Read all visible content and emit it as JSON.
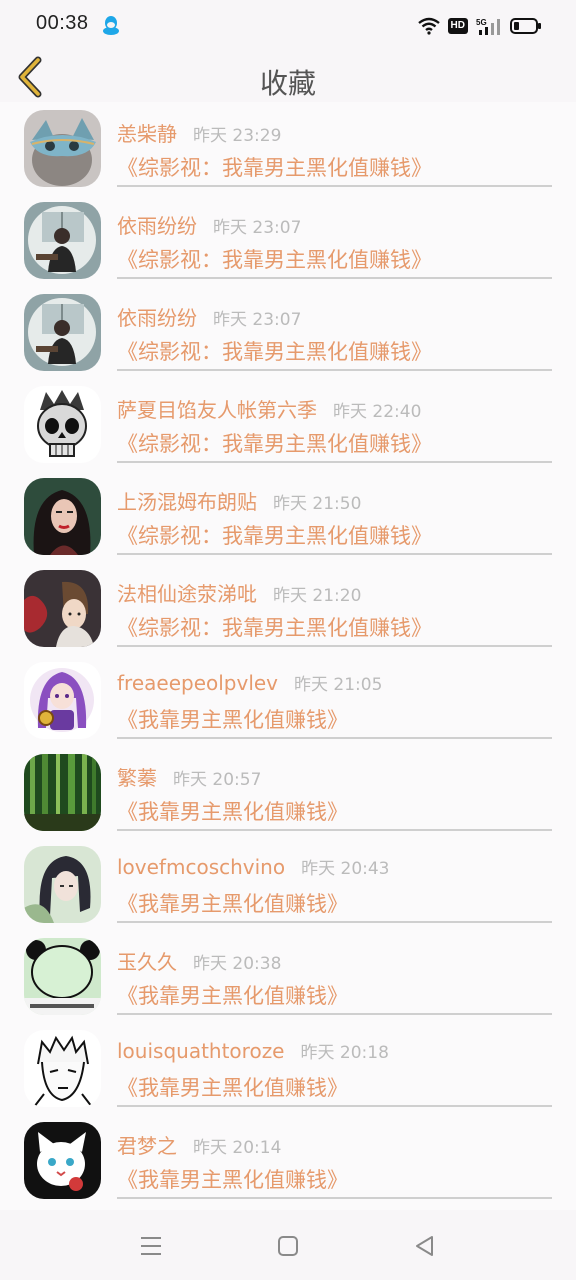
{
  "status_bar": {
    "time": "00:38",
    "hd": "HD",
    "network": "5G"
  },
  "header": {
    "title": "收藏"
  },
  "items": [
    {
      "name": "恙柴静",
      "time": "昨天 23:29",
      "book": "《综影视：我靠男主黑化值赚钱》",
      "avatar": "cat-mask-avatar"
    },
    {
      "name": "依雨纷纷",
      "time": "昨天 23:07",
      "book": "《综影视：我靠男主黑化值赚钱》",
      "avatar": "man-fisheye-avatar"
    },
    {
      "name": "依雨纷纷",
      "time": "昨天 23:07",
      "book": "《综影视：我靠男主黑化值赚钱》",
      "avatar": "man-fisheye-avatar"
    },
    {
      "name": "萨夏目馅友人帐第六季",
      "time": "昨天 22:40",
      "book": "《综影视：我靠男主黑化值赚钱》",
      "avatar": "crowned-skull-avatar"
    },
    {
      "name": "上汤混姆布朗贴",
      "time": "昨天 21:50",
      "book": "《综影视：我靠男主黑化值赚钱》",
      "avatar": "woman-portrait-avatar"
    },
    {
      "name": "法相仙途荥涕吡",
      "time": "昨天 21:20",
      "book": "《综影视：我靠男主黑化值赚钱》",
      "avatar": "anime-boy-avatar"
    },
    {
      "name": "freaeepeolpvlev",
      "time": "昨天 21:05",
      "book": "《我靠男主黑化值赚钱》",
      "avatar": "purple-anime-girl-avatar"
    },
    {
      "name": "繁蓁",
      "time": "昨天 20:57",
      "book": "《我靠男主黑化值赚钱》",
      "avatar": "bamboo-forest-avatar"
    },
    {
      "name": "lovefmcoschvino",
      "time": "昨天 20:43",
      "book": "《我靠男主黑化值赚钱》",
      "avatar": "anime-dark-hair-avatar"
    },
    {
      "name": "玉久久",
      "time": "昨天 20:38",
      "book": "《我靠男主黑化值赚钱》",
      "avatar": "panda-meme-avatar"
    },
    {
      "name": "louisquathtoroze",
      "time": "昨天 20:18",
      "book": "《我靠男主黑化值赚钱》",
      "avatar": "manga-sketch-avatar"
    },
    {
      "name": "君梦之",
      "time": "昨天 20:14",
      "book": "《我靠男主黑化值赚钱》",
      "avatar": "white-cat-avatar"
    }
  ],
  "colors": {
    "accent": "#e69a6c",
    "time_gray": "#bbbbbb",
    "back_arrow": "#e0b43a"
  }
}
